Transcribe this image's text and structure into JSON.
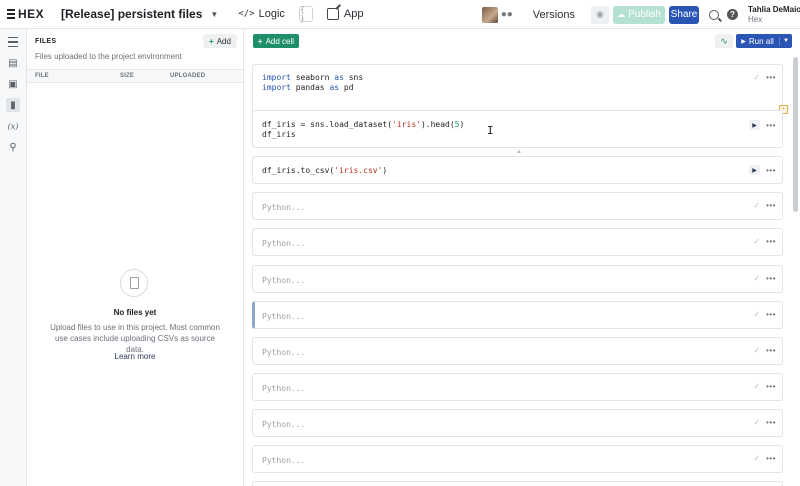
{
  "app": {
    "logo_text": "HEX",
    "project_title": "[Release] persistent files",
    "mode_logic": "Logic",
    "mode_logic_glyph": "</>",
    "mode_app": "App",
    "versions": "Versions",
    "publish": "Publish",
    "share": "Share",
    "user_name": "Tahlia DeMaio",
    "user_org": "Hex"
  },
  "files_panel": {
    "title": "FILES",
    "subtitle": "Files uploaded to the project environment",
    "add_label": "Add",
    "columns": [
      "FILE",
      "SIZE",
      "UPLOADED"
    ],
    "empty_title": "No files yet",
    "empty_desc": "Upload files to use in this project. Most common use cases include uploading CSVs as source data.",
    "learn_more": "Learn more"
  },
  "notebook": {
    "add_cell_label": "Add cell",
    "run_all_label": "Run all",
    "placeholder": "Python...",
    "cell1": {
      "line1_kw1": "import",
      "line1_mod": " seaborn ",
      "line1_kw2": "as",
      "line1_alias": " sns",
      "line2_kw1": "import",
      "line2_mod": " pandas ",
      "line2_kw2": "as",
      "line2_alias": " pd"
    },
    "cell2": {
      "line1_a": "df_iris = sns.load_dataset(",
      "line1_str": "'iris'",
      "line1_b": ").head(",
      "line1_num": "5",
      "line1_c": ")",
      "line2": "df_iris"
    },
    "cell3": {
      "line1_a": "df_iris.to_csv(",
      "line1_str": "'iris.csv'",
      "line1_b": ")"
    }
  },
  "colors": {
    "accent_green": "#1f8f6a",
    "brand_blue": "#2a55b5",
    "publish_disabled": "#b5e0d4"
  }
}
